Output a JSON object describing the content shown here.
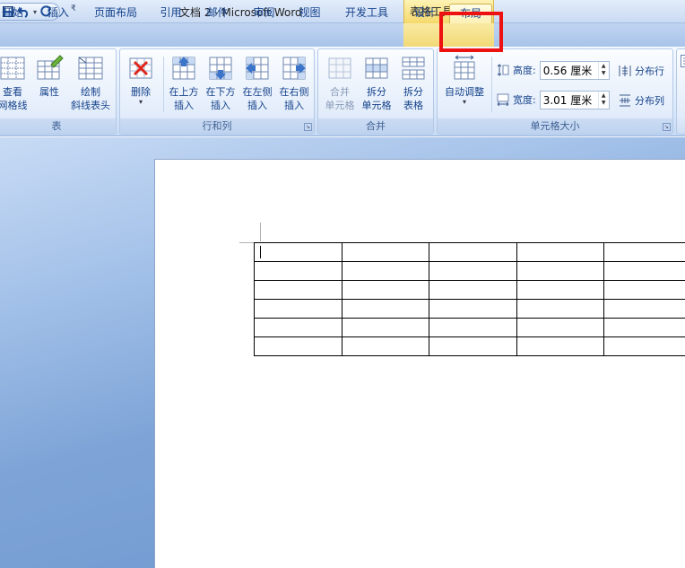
{
  "window": {
    "title": "文档 2 - Microsoft Word",
    "context_tool_title": "表格工具"
  },
  "quick_access": {
    "more_glyph": "₹"
  },
  "tabs": [
    {
      "label": "开始"
    },
    {
      "label": "插入"
    },
    {
      "label": "页面布局"
    },
    {
      "label": "引用"
    },
    {
      "label": "邮件"
    },
    {
      "label": "审阅"
    },
    {
      "label": "视图"
    },
    {
      "label": "开发工具"
    },
    {
      "label": "设计"
    },
    {
      "label": "布局",
      "active": true
    }
  ],
  "ribbon": {
    "table_group": {
      "label": "表",
      "view_gridlines": "查看\n网格线",
      "properties": "属性",
      "draw_diagonal": "绘制\n斜线表头"
    },
    "rows_cols_group": {
      "label": "行和列",
      "delete": "删除",
      "insert_above": "在上方\n插入",
      "insert_below": "在下方\n插入",
      "insert_left": "在左侧\n插入",
      "insert_right": "在右侧\n插入"
    },
    "merge_group": {
      "label": "合并",
      "merge_cells": "合并\n单元格",
      "split_cells": "拆分\n单元格",
      "split_table": "拆分\n表格"
    },
    "cell_size_group": {
      "label": "单元格大小",
      "autofit": "自动调整",
      "height_label": "高度:",
      "height_value": "0.56 厘米",
      "width_label": "宽度:",
      "width_value": "3.01 厘米",
      "distribute_rows": "分布行",
      "distribute_cols": "分布列"
    }
  },
  "document": {
    "table": {
      "rows": 6,
      "cols": 5
    }
  },
  "colors": {
    "accent": "#15428b",
    "context_tab": "#f5d96b",
    "highlight": "#ee1111"
  }
}
